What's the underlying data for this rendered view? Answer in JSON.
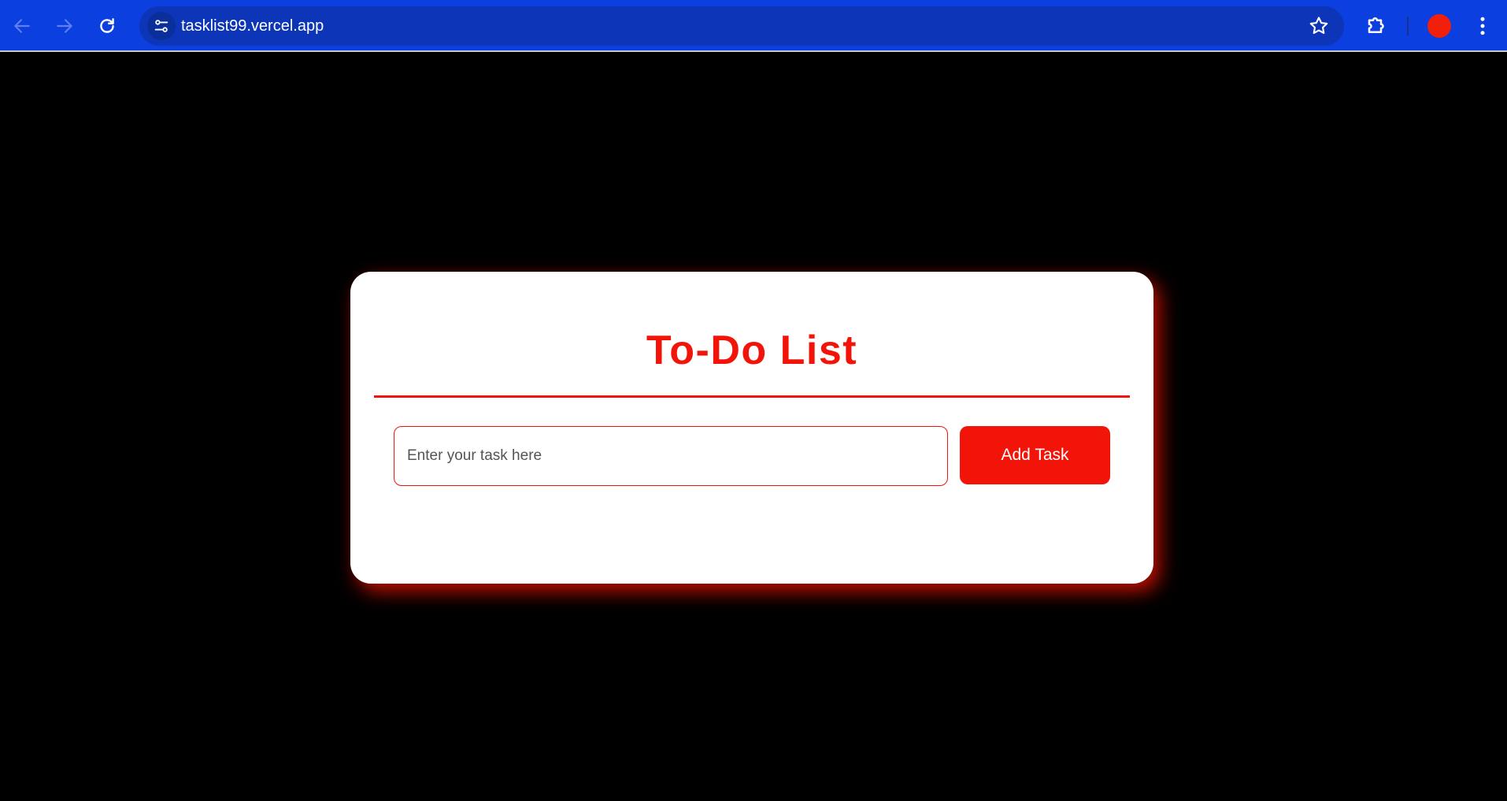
{
  "browser": {
    "url": "tasklist99.vercel.app",
    "icons": {
      "back": "arrow-left-icon",
      "forward": "arrow-right-icon",
      "reload": "reload-icon",
      "site_info": "tune-icon",
      "bookmark": "star-icon",
      "extensions": "puzzle-icon",
      "profile": "avatar",
      "menu": "kebab-menu-icon"
    },
    "colors": {
      "toolbar": "#0b3fe0",
      "omnibox": "#0d35b8",
      "avatar": "#f21f0a"
    }
  },
  "app": {
    "title": "To-Do List",
    "input": {
      "placeholder": "Enter your task here",
      "value": ""
    },
    "add_button_label": "Add Task",
    "colors": {
      "accent": "#f21408",
      "background": "#000000",
      "card": "#ffffff"
    }
  }
}
